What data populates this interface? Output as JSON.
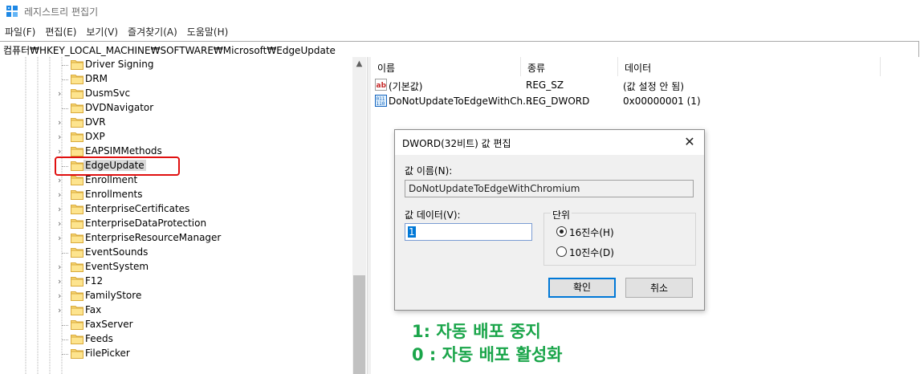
{
  "window": {
    "title": "레지스트리 편집기"
  },
  "menu": [
    "파일(F)",
    "편집(E)",
    "보기(V)",
    "즐겨찾기(A)",
    "도움말(H)"
  ],
  "address": "컴퓨터₩HKEY_LOCAL_MACHINE₩SOFTWARE₩Microsoft₩EdgeUpdate",
  "tree": {
    "items": [
      {
        "label": "Driver Signing",
        "expandable": false
      },
      {
        "label": "DRM",
        "expandable": false
      },
      {
        "label": "DusmSvc",
        "expandable": true
      },
      {
        "label": "DVDNavigator",
        "expandable": false
      },
      {
        "label": "DVR",
        "expandable": true
      },
      {
        "label": "DXP",
        "expandable": true
      },
      {
        "label": "EAPSIMMethods",
        "expandable": true
      },
      {
        "label": "EdgeUpdate",
        "expandable": false,
        "selected": true
      },
      {
        "label": "Enrollment",
        "expandable": true
      },
      {
        "label": "Enrollments",
        "expandable": true
      },
      {
        "label": "EnterpriseCertificates",
        "expandable": true
      },
      {
        "label": "EnterpriseDataProtection",
        "expandable": true
      },
      {
        "label": "EnterpriseResourceManager",
        "expandable": true
      },
      {
        "label": "EventSounds",
        "expandable": false
      },
      {
        "label": "EventSystem",
        "expandable": true
      },
      {
        "label": "F12",
        "expandable": true
      },
      {
        "label": "FamilyStore",
        "expandable": true
      },
      {
        "label": "Fax",
        "expandable": true
      },
      {
        "label": "FaxServer",
        "expandable": false
      },
      {
        "label": "Feeds",
        "expandable": false
      },
      {
        "label": "FilePicker",
        "expandable": false
      }
    ]
  },
  "list": {
    "headers": [
      "이름",
      "종류",
      "데이터"
    ],
    "rows": [
      {
        "icon": "string-value-icon",
        "name": "(기본값)",
        "type": "REG_SZ",
        "data": "(값 설정 안 됨)"
      },
      {
        "icon": "binary-value-icon",
        "name": "DoNotUpdateToEdgeWithCh...",
        "type": "REG_DWORD",
        "data": "0x00000001 (1)"
      }
    ]
  },
  "dialog": {
    "title": "DWORD(32비트) 값 편집",
    "close": "✕",
    "name_label": "값 이름(N):",
    "name_value": "DoNotUpdateToEdgeWithChromium",
    "data_label": "값 데이터(V):",
    "data_value": "1",
    "unit_label": "단위",
    "radio_hex": "16진수(H)",
    "radio_dec": "10진수(D)",
    "ok": "확인",
    "cancel": "취소"
  },
  "caption": {
    "line1": "1: 자동 배포 중지",
    "line2": "0 : 자동 배포 활성화"
  },
  "colors": {
    "highlight": "#e01010",
    "caption": "#1aa54a",
    "accent": "#0078d7"
  }
}
